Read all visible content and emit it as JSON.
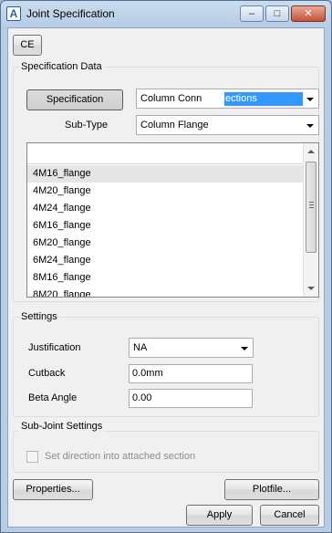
{
  "window": {
    "title": "Joint Specification",
    "icon": "app-logo-icon"
  },
  "titlebar_buttons": {
    "minimize": "–",
    "maximize": "□",
    "close": "✕"
  },
  "toolbar": {
    "ce_label": "CE"
  },
  "spec_data": {
    "group_label": "Specification Data",
    "specification_button": "Specification",
    "specification_value_prefix": "Column Conn",
    "specification_value_selected": "ections",
    "subtype_label": "Sub-Type",
    "subtype_value": "Column Flange",
    "list_items": [
      "4M16_flange",
      "4M20_flange",
      "4M24_flange",
      "6M16_flange",
      "6M20_flange",
      "6M24_flange",
      "8M16_flange",
      "8M20_flange"
    ]
  },
  "settings": {
    "group_label": "Settings",
    "justification_label": "Justification",
    "justification_value": "NA",
    "cutback_label": "Cutback",
    "cutback_value": "0.0mm",
    "beta_label": "Beta Angle",
    "beta_value": "0.00"
  },
  "subjoint": {
    "group_label": "Sub-Joint Settings",
    "checkbox_label": "Set direction into attached section",
    "checked": false
  },
  "footer": {
    "properties_label": "Properties...",
    "plotfile_label": "Plotfile...",
    "apply_label": "Apply",
    "cancel_label": "Cancel"
  }
}
